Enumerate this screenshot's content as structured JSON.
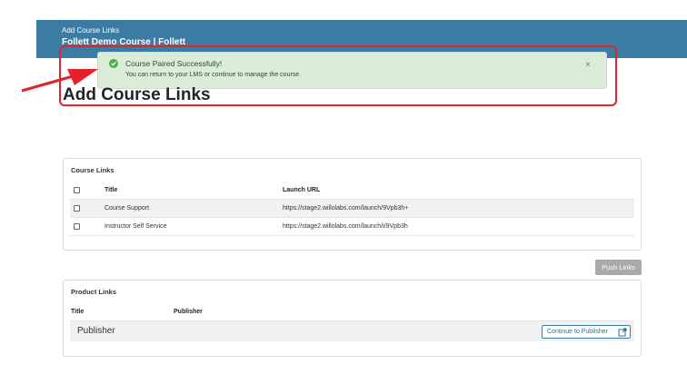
{
  "header": {
    "small_title": "Add Course Links",
    "course_name": "Follett Demo Course | Follett"
  },
  "alert": {
    "title": "Course Paired Successfully!",
    "message": "You can return to your LMS or continue to manage the course.",
    "close": "×",
    "icon": "check-circle-icon",
    "color": "#dbecd9"
  },
  "page": {
    "heading": "Add Course Links"
  },
  "course_links": {
    "title": "Course Links",
    "columns": [
      "Title",
      "Launch URL"
    ],
    "rows": [
      {
        "title": "Course Support",
        "url": "https://stage2.willolabs.com/launch/9Vpb3h+"
      },
      {
        "title": "Instructor Self Service",
        "url": "https://stage2.willolabs.com/launch/i/9Vpb3h"
      }
    ]
  },
  "push_button": "Push Links",
  "product_links": {
    "title": "Product Links",
    "columns": [
      "Title",
      "Publisher"
    ],
    "rows": [
      {
        "title": "Publisher",
        "button": "Continue to Publisher",
        "icon": "external-link-icon"
      }
    ]
  },
  "colors": {
    "header": "#3c7ca3",
    "annotation": "#e5222a",
    "push_button": "#a9aaab"
  }
}
